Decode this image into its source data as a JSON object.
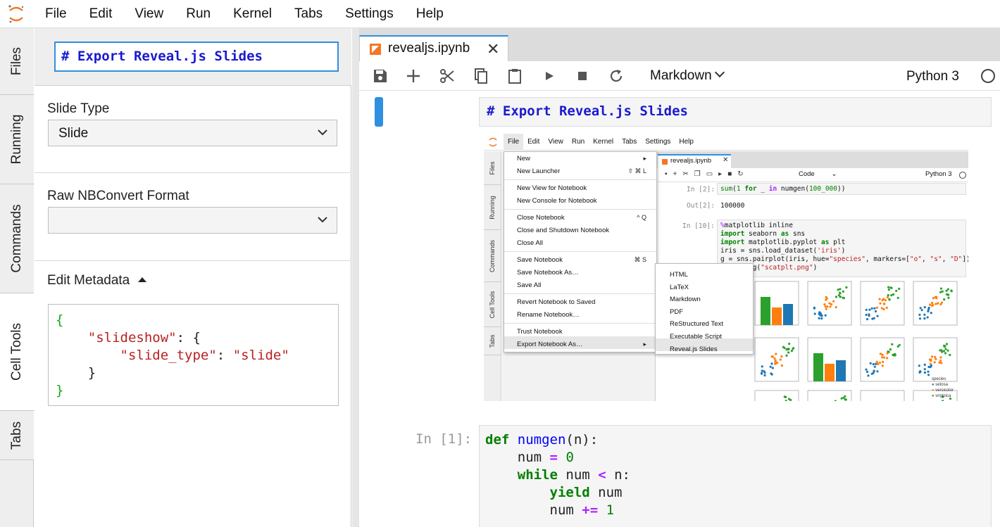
{
  "menubar": {
    "items": [
      "File",
      "Edit",
      "View",
      "Run",
      "Kernel",
      "Tabs",
      "Settings",
      "Help"
    ]
  },
  "left_tabs": [
    "Files",
    "Running",
    "Commands",
    "Cell Tools",
    "Tabs"
  ],
  "active_left_tab": "Cell Tools",
  "cell_tools": {
    "preview": "# Export Reveal.js Slides",
    "slide_type_label": "Slide Type",
    "slide_type_value": "Slide",
    "raw_format_label": "Raw NBConvert Format",
    "raw_format_value": "",
    "edit_metadata_label": "Edit Metadata",
    "metadata": {
      "open_brace": "{",
      "key1": "\"slideshow\"",
      "colon1": ": {",
      "key2": "\"slide_type\"",
      "colon2": ": ",
      "value2": "\"slide\"",
      "inner_close": "}",
      "close_brace": "}"
    }
  },
  "document_tab": {
    "label": "revealjs.ipynb",
    "close": "✕"
  },
  "toolbar": {
    "icons": [
      "save-icon",
      "add-icon",
      "cut-icon",
      "copy-icon",
      "paste-icon",
      "run-icon",
      "stop-icon",
      "restart-icon"
    ],
    "cell_type": "Markdown",
    "kernel_name": "Python 3"
  },
  "cells": {
    "markdown_source": "# Export Reveal.js Slides",
    "code_prompt": "In [1]:",
    "code": {
      "l1_kw": "def",
      "l1_fn": "numgen",
      "l1_rest": "(n):",
      "l2_a": "num",
      "l2_op": "=",
      "l2_num": "0",
      "l3_kw": "while",
      "l3_a": "num",
      "l3_op": "<",
      "l3_b": "n:",
      "l4_kw": "yield",
      "l4_a": "num",
      "l5_a": "num",
      "l5_op": "+=",
      "l5_num": "1"
    }
  },
  "embedded_screenshot": {
    "menus": [
      "File",
      "Edit",
      "View",
      "Run",
      "Kernel",
      "Tabs",
      "Settings",
      "Help"
    ],
    "left_tabs": [
      "Files",
      "Running",
      "Commands",
      "Cell Tools",
      "Tabs"
    ],
    "file_menu": [
      {
        "label": "New",
        "key": "▸"
      },
      {
        "label": "New Launcher",
        "key": "⇧ ⌘ L"
      },
      {
        "label": "New View for Notebook",
        "key": ""
      },
      {
        "label": "New Console for Notebook",
        "key": ""
      },
      {
        "label": "Close Notebook",
        "key": "^ Q"
      },
      {
        "label": "Close and Shutdown Notebook",
        "key": ""
      },
      {
        "label": "Close All",
        "key": ""
      },
      {
        "label": "Save Notebook",
        "key": "⌘ S"
      },
      {
        "label": "Save Notebook As…",
        "key": ""
      },
      {
        "label": "Save All",
        "key": ""
      },
      {
        "label": "Revert Notebook to Saved",
        "key": ""
      },
      {
        "label": "Rename Notebook…",
        "key": ""
      },
      {
        "label": "Trust Notebook",
        "key": ""
      },
      {
        "label": "Export Notebook As…",
        "key": "▸"
      }
    ],
    "export_menu": [
      "HTML",
      "LaTeX",
      "Markdown",
      "PDF",
      "ReStructured Text",
      "Executable Script",
      "Reveal.js Slides"
    ],
    "tab_label": "revealjs.ipynb",
    "cell_type": "Code",
    "kernel": "Python 3",
    "prompt_in2": "In [2]:",
    "prompt_out2": "Out[2]:",
    "out2_value": "100000",
    "prompt_in10": "In [10]:",
    "legend_title": "species",
    "legend_items": [
      "setosa",
      "versicolor",
      "virginica"
    ],
    "colors": {
      "setosa": "#1f77b4",
      "versicolor": "#ff7f0e",
      "virginica": "#2ca02c"
    }
  },
  "colors": {
    "accent": "#2f8fe0",
    "markdown_heading": "#1a1ad0",
    "notebook_icon": "#f37726"
  }
}
